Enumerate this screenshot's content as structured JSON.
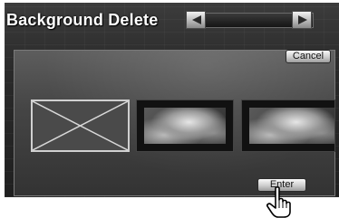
{
  "header": {
    "title": "Background Delete"
  },
  "buttons": {
    "cancel_label": "Cancel",
    "enter_label": "Enter"
  },
  "thumbnails": [
    {
      "state": "selected",
      "content": "none"
    },
    {
      "state": "normal",
      "content": "image"
    },
    {
      "state": "normal",
      "content": "image"
    }
  ],
  "icons": {
    "prev": "left-arrow-icon",
    "next": "right-arrow-icon",
    "pointer": "pointing-hand-icon"
  }
}
